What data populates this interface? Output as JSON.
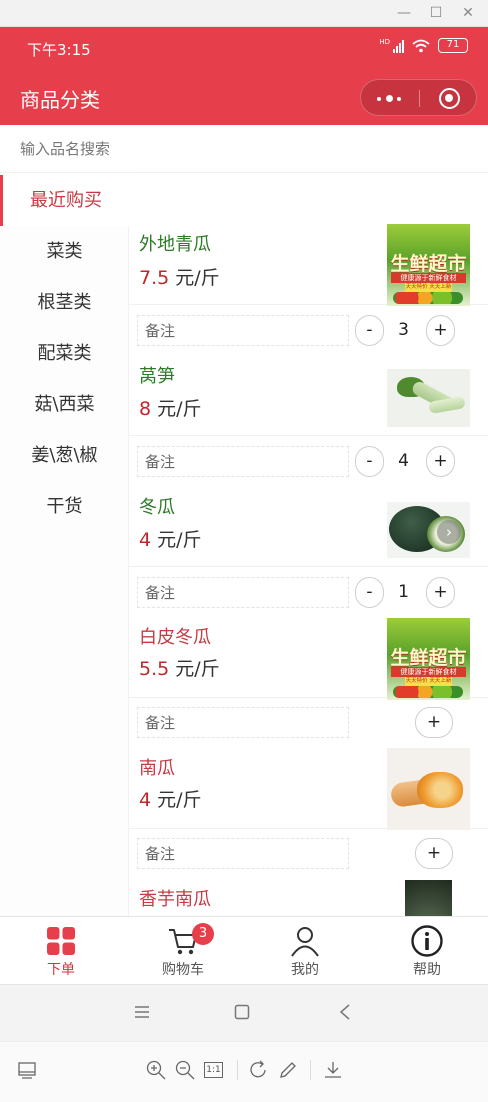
{
  "window": {
    "minimize": "—",
    "maximize": "☐",
    "close": "✕"
  },
  "status_bar": {
    "time": "下午3:15",
    "signal": "HD",
    "battery": "71"
  },
  "nav": {
    "title": "商品分类"
  },
  "search": {
    "placeholder": "输入品名搜索"
  },
  "categories": [
    {
      "label": "最近购买",
      "active": true
    },
    {
      "label": "菜类",
      "active": false
    },
    {
      "label": "根茎类",
      "active": false
    },
    {
      "label": "配菜类",
      "active": false
    },
    {
      "label": "菇\\西菜",
      "active": false
    },
    {
      "label": "姜\\葱\\椒",
      "active": false
    },
    {
      "label": "干货",
      "active": false
    }
  ],
  "products": [
    {
      "name": "外地青瓜",
      "price": "7.5",
      "unit": "元/斤",
      "qty": "3",
      "note_placeholder": "备注",
      "in_cart": true,
      "image": "supermarket-banner",
      "name_color": "green"
    },
    {
      "name": "莴笋",
      "price": "8",
      "unit": "元/斤",
      "qty": "4",
      "note_placeholder": "备注",
      "in_cart": true,
      "image": "lettuce-stem-photo",
      "name_color": "green"
    },
    {
      "name": "冬瓜",
      "price": "4",
      "unit": "元/斤",
      "qty": "1",
      "note_placeholder": "备注",
      "in_cart": true,
      "image": "winter-melon-photo",
      "name_color": "green"
    },
    {
      "name": "白皮冬瓜",
      "price": "5.5",
      "unit": "元/斤",
      "qty": "",
      "note_placeholder": "备注",
      "in_cart": false,
      "image": "supermarket-banner",
      "name_color": "red"
    },
    {
      "name": "南瓜",
      "price": "4",
      "unit": "元/斤",
      "qty": "",
      "note_placeholder": "备注",
      "in_cart": false,
      "image": "pumpkin-photo",
      "name_color": "red"
    },
    {
      "name": "香芋南瓜",
      "price": "",
      "unit": "",
      "qty": "",
      "note_placeholder": "备注",
      "in_cart": false,
      "image": "taro-pumpkin-photo",
      "name_color": "red"
    }
  ],
  "stepper": {
    "minus": "-",
    "plus": "+"
  },
  "banner_text": {
    "headline": "生鲜超市",
    "subline": "健康源于新鲜食材",
    "tag1": "天天特价",
    "tag2": "天天上新"
  },
  "tabbar": [
    {
      "label": "下单",
      "icon": "grid-icon",
      "active": true
    },
    {
      "label": "购物车",
      "icon": "cart-icon",
      "active": false,
      "badge": "3"
    },
    {
      "label": "我的",
      "icon": "user-icon",
      "active": false
    },
    {
      "label": "帮助",
      "icon": "info-icon",
      "active": false
    }
  ],
  "viewer": {
    "zoom_actual": "1:1"
  },
  "colors": {
    "brand": "#e63e4b",
    "price": "#c0272d",
    "green_name": "#2d7a28",
    "red_name": "#c83a43"
  }
}
